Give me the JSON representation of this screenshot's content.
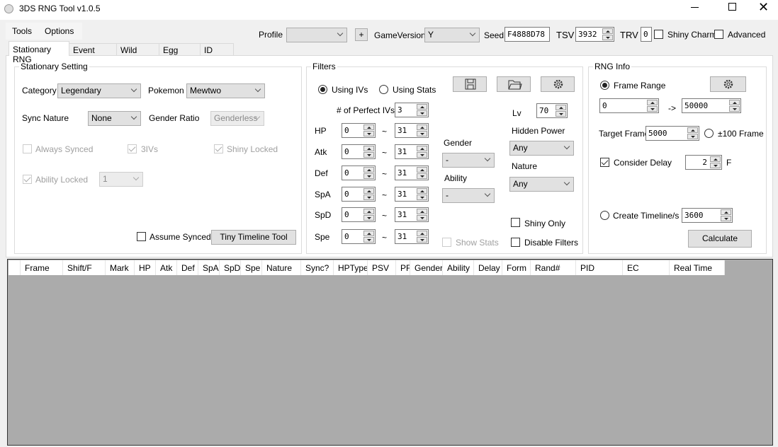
{
  "window": {
    "title": "3DS RNG Tool v1.0.5"
  },
  "menu": [
    "Tools",
    "Options"
  ],
  "toolbar": {
    "profile_label": "Profile",
    "profile_value": "",
    "add_label": "+",
    "gameversion_label": "GameVersion",
    "gameversion_value": "Y",
    "seed_label": "Seed",
    "seed_value": "F4888D78",
    "tsv_label": "TSV",
    "tsv_value": "3932",
    "trv_label": "TRV",
    "trv_value": "0",
    "shiny_charm": "Shiny Charm",
    "shiny_charm_checked": false,
    "advanced": "Advanced",
    "advanced_checked": false
  },
  "tabs": [
    {
      "label": "Stationary RNG",
      "selected": true
    },
    {
      "label": "Event RNG"
    },
    {
      "label": "Wild RNG"
    },
    {
      "label": "Egg RNG"
    },
    {
      "label": "ID RNG"
    }
  ],
  "stationary": {
    "title": "Stationary Setting",
    "category_label": "Category",
    "category_value": "Legendary",
    "pokemon_label": "Pokemon",
    "pokemon_value": "Mewtwo",
    "sync_nature_label": "Sync Nature",
    "sync_nature_value": "None",
    "gender_ratio_label": "Gender Ratio",
    "gender_ratio_value": "Genderless",
    "always_synced": "Always Synced",
    "three_ivs": "3IVs",
    "shiny_locked": "Shiny Locked",
    "ability_locked": "Ability Locked",
    "ability_value": "1",
    "assume_synced": "Assume Synced",
    "tiny_timeline": "Tiny Timeline Tool"
  },
  "filters": {
    "title": "Filters",
    "using_ivs": "Using IVs",
    "using_stats": "Using Stats",
    "perfect_ivs_label": "# of Perfect IVs",
    "perfect_ivs_value": "3",
    "tilde": "~",
    "ivs": [
      {
        "stat": "HP",
        "min": "0",
        "max": "31"
      },
      {
        "stat": "Atk",
        "min": "0",
        "max": "31"
      },
      {
        "stat": "Def",
        "min": "0",
        "max": "31"
      },
      {
        "stat": "SpA",
        "min": "0",
        "max": "31"
      },
      {
        "stat": "SpD",
        "min": "0",
        "max": "31"
      },
      {
        "stat": "Spe",
        "min": "0",
        "max": "31"
      }
    ],
    "lv_label": "Lv",
    "lv_value": "70",
    "hidden_power_label": "Hidden Power",
    "hidden_power_value": "Any",
    "nature_label": "Nature",
    "nature_value": "Any",
    "gender_label": "Gender",
    "gender_value": "-",
    "ability_label": "Ability",
    "ability_value": "-",
    "shiny_only": "Shiny Only",
    "disable_filters": "Disable Filters",
    "show_stats": "Show Stats"
  },
  "rng_info": {
    "title": "RNG Info",
    "frame_range": "Frame Range",
    "frame_min": "0",
    "arrow": "->",
    "frame_max": "50000",
    "target_frame_label": "Target Frame",
    "target_frame_value": "5000",
    "plus_minus_100": "±100 Frame",
    "consider_delay": "Consider Delay",
    "delay_value": "2",
    "delay_unit": "F",
    "create_timeline": "Create Timeline/s",
    "timeline_value": "3600",
    "calculate": "Calculate"
  },
  "grid": {
    "columns": [
      "Frame",
      "Shift/F",
      "Mark",
      "HP",
      "Atk",
      "Def",
      "SpA",
      "SpD",
      "Spe",
      "Nature",
      "Sync?",
      "HPType",
      "PSV",
      "PF",
      "Gender",
      "Ability",
      "Delay",
      "Form",
      "Rand#",
      "PID",
      "EC",
      "Real Time"
    ],
    "rows": []
  }
}
